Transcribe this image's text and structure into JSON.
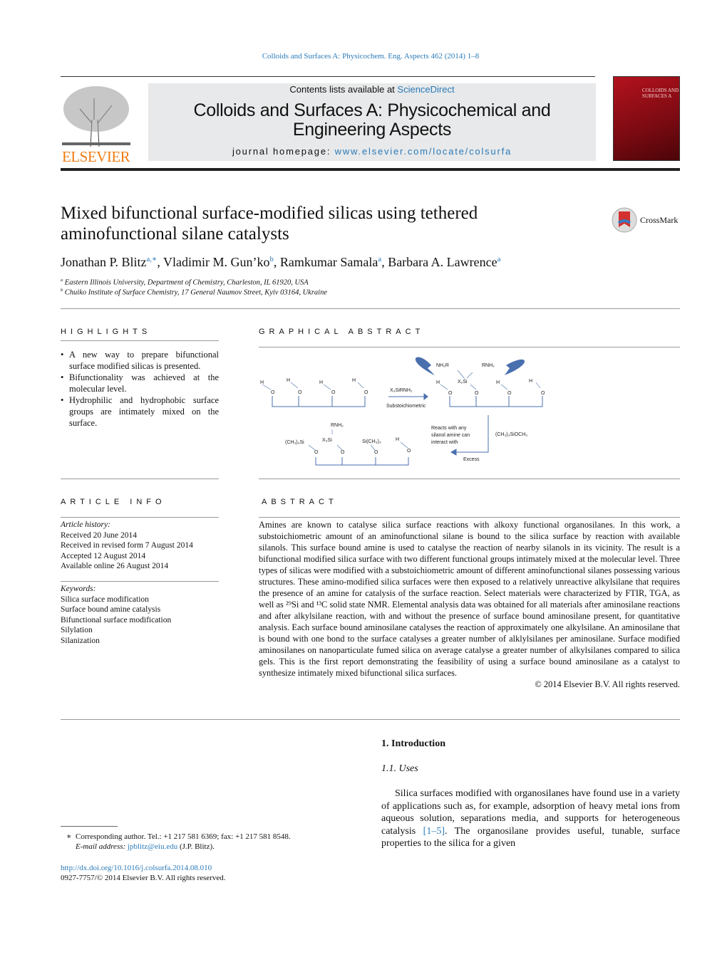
{
  "header": {
    "citation": "Colloids and Surfaces A: Physicochem. Eng. Aspects 462 (2014) 1–8",
    "contents_prefix": "Contents lists available at ",
    "contents_link": "ScienceDirect",
    "journal_title_1": "Colloids and Surfaces A: Physicochemical and",
    "journal_title_2": "Engineering Aspects",
    "homepage_prefix": "journal homepage: ",
    "homepage_link": "www.elsevier.com/locate/colsurfa",
    "publisher_logo": "ELSEVIER",
    "cover_text": "COLLOIDS AND SURFACES A",
    "crossmark": "CrossMark",
    "accent": "#2a7ab8",
    "elsevier_color": "#f07c12"
  },
  "article": {
    "title_1": "Mixed bifunctional surface-modified silicas using tethered",
    "title_2": "aminofunctional silane catalysts",
    "authors": [
      {
        "name": "Jonathan P. Blitz",
        "sup": "a,∗"
      },
      {
        "name": "Vladimir M. Gun’ko",
        "sup": "b"
      },
      {
        "name": "Ramkumar Samala",
        "sup": "a"
      },
      {
        "name": "Barbara A. Lawrence",
        "sup": "a"
      }
    ],
    "affiliations": [
      {
        "mark": "a",
        "text": "Eastern Illinois University, Department of Chemistry, Charleston, IL 61920, USA"
      },
      {
        "mark": "b",
        "text": "Chuiko Institute of Surface Chemistry, 17 General Naumov Street, Kyiv 03164, Ukraine"
      }
    ]
  },
  "highlights": {
    "heading": "HIGHLIGHTS",
    "items": [
      "A new way to prepare bifunctional surface modified silicas is presented.",
      "Bifunctionality was achieved at the molecular level.",
      "Hydrophilic and hydrophobic surface groups are intimately mixed on the surface."
    ]
  },
  "graphical_abstract": {
    "heading": "GRAPHICAL ABSTRACT",
    "labels": {
      "reagent": "X₃SiRNH₂",
      "substoich": "Substoichiometric",
      "nh2r": "NH₂R",
      "rnh2": "RNH₂",
      "x2si": "X₂Si",
      "x3si": "X₃Si",
      "tms": "(CH₃)₃Si",
      "sime3": "Si(CH₃)₃",
      "reacts1": "Reacts with any",
      "reacts2": "silanol amine can",
      "reacts3": "interact with",
      "silane": "(CH₃)₃SiOCH₃",
      "excess": "Excess",
      "h": "H",
      "o": "O"
    },
    "arrow_color": "#4a6fae"
  },
  "article_info": {
    "heading": "ARTICLE INFO",
    "history_label": "Article history:",
    "history": [
      "Received 20 June 2014",
      "Received in revised form 7 August 2014",
      "Accepted 12 August 2014",
      "Available online 26 August 2014"
    ],
    "keywords_label": "Keywords:",
    "keywords": [
      "Silica surface modification",
      "Surface bound amine catalysis",
      "Bifunctional surface modification",
      "Silylation",
      "Silanization"
    ]
  },
  "abstract": {
    "heading": "ABSTRACT",
    "text": "Amines are known to catalyse silica surface reactions with alkoxy functional organosilanes. In this work, a substoichiometric amount of an aminofunctional silane is bound to the silica surface by reaction with available silanols. This surface bound amine is used to catalyse the reaction of nearby silanols in its vicinity. The result is a bifunctional modified silica surface with two different functional groups intimately mixed at the molecular level. Three types of silicas were modified with a substoichiometric amount of different aminofunctional silanes possessing various structures. These amino-modified silica surfaces were then exposed to a relatively unreactive alkylsilane that requires the presence of an amine for catalysis of the surface reaction. Select materials were characterized by FTIR, TGA, as well as ²⁹Si and ¹³C solid state NMR. Elemental analysis data was obtained for all materials after aminosilane reactions and after alkylsilane reaction, with and without the presence of surface bound aminosilane present, for quantitative analysis. Each surface bound aminosilane catalyses the reaction of approximately one alkylsilane. An aminosilane that is bound with one bond to the surface catalyses a greater number of alklylsilanes per aminosilane. Surface modified aminosilanes on nanoparticulate fumed silica on average catalyse a greater number of alkylsilanes compared to silica gels. This is the first report demonstrating the feasibility of using a surface bound aminosilane as a catalyst to synthesize intimately mixed bifunctional silica surfaces.",
    "copyright": "© 2014 Elsevier B.V. All rights reserved."
  },
  "intro": {
    "heading": "1.  Introduction",
    "subheading": "1.1.  Uses",
    "para_1": "Silica surfaces modified with organosilanes have found use in a variety of applications such as, for example, adsorption of heavy metal ions from aqueous solution, separations media, and supports for heterogeneous catalysis ",
    "ref": "[1–5]",
    "para_2": ". The organosilane provides useful, tunable, surface properties to the silica for a given"
  },
  "footnote": {
    "mark": "∗",
    "text": "Corresponding author. Tel.: +1 217 581 6369; fax: +1 217 581 8548.",
    "email_label": "E-mail address: ",
    "email": "jpblitz@eiu.edu",
    "email_suffix": " (J.P. Blitz).",
    "doi": "http://dx.doi.org/10.1016/j.colsurfa.2014.08.010",
    "issn": "0927-7757/© 2014 Elsevier B.V. All rights reserved."
  }
}
